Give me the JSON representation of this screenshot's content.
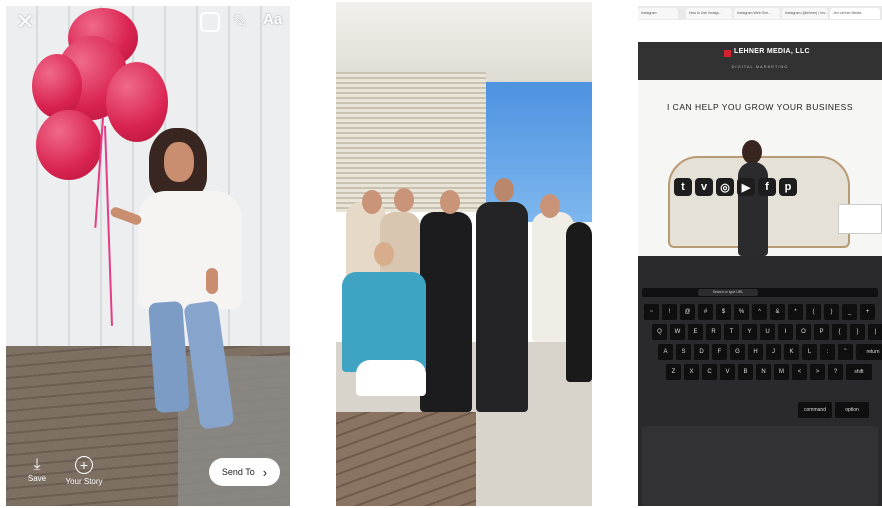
{
  "story_editor": {
    "close_icon": "close-icon",
    "sticker_icon": "sticker-icon",
    "draw_icon": "pen-icon",
    "text_tool_label": "Aa",
    "save_label": "Save",
    "your_story_label": "Your Story",
    "send_to_label": "Send To"
  },
  "laptop_screen": {
    "tabs": [
      "Instagram",
      "How to Use Instagr...",
      "Instagram Web Gen...",
      "Instagram (@lehner) • Ins...",
      "Jen Lehner Media"
    ],
    "logo_text": "LEHNER MEDIA, LLC",
    "logo_subtitle": "DIGITAL MARKETING",
    "headline": "I CAN HELP YOU GROW YOUR BUSINESS",
    "social_icons": [
      "twitter-icon",
      "vimeo-icon",
      "instagram-icon",
      "youtube-icon",
      "facebook-icon",
      "pinterest-icon"
    ],
    "touchbar_search": "Search or type URL",
    "keyboard_rows": [
      [
        "~",
        "!",
        "@",
        "#",
        "$",
        "%",
        "^",
        "&",
        "*",
        "(",
        ")",
        "_",
        "+"
      ],
      [
        "Q",
        "W",
        "E",
        "R",
        "T",
        "Y",
        "U",
        "I",
        "O",
        "P",
        "{",
        "}",
        "|"
      ],
      [
        "A",
        "S",
        "D",
        "F",
        "G",
        "H",
        "J",
        "K",
        "L",
        ":",
        "\"",
        "return"
      ],
      [
        "Z",
        "X",
        "C",
        "V",
        "B",
        "N",
        "M",
        "<",
        ">",
        "?",
        "shift"
      ],
      [
        "command",
        "option"
      ]
    ]
  }
}
